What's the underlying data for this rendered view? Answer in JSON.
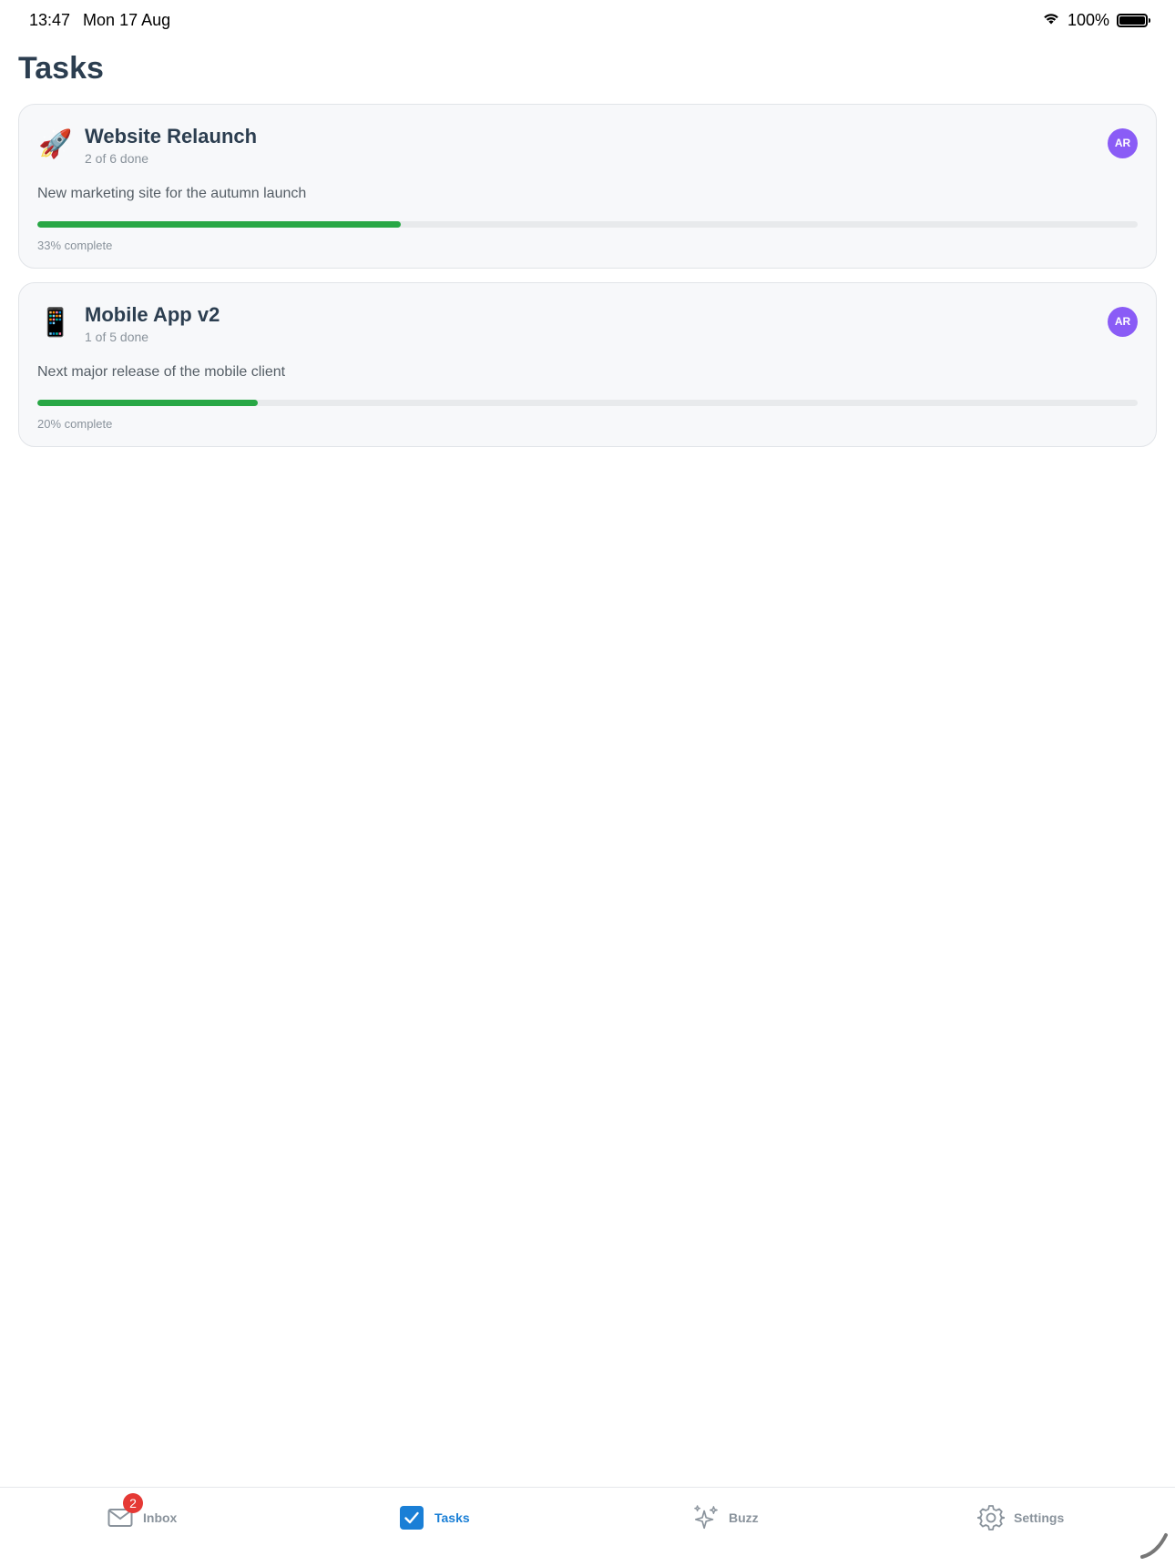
{
  "status_bar": {
    "time": "13:47",
    "date": "Mon 17 Aug",
    "battery": "100%"
  },
  "page": {
    "title": "Tasks"
  },
  "projects": [
    {
      "emoji": "🚀",
      "name": "Website Relaunch",
      "count": "2 of 6 done",
      "description": "New marketing site for the autumn launch",
      "progress": 0.33,
      "progress_text": "33% complete",
      "avatar": "AR"
    },
    {
      "emoji": "📱",
      "name": "Mobile App v2",
      "count": "1 of 5 done",
      "description": "Next major release of the mobile client",
      "progress": 0.2,
      "progress_text": "20% complete",
      "avatar": "AR"
    }
  ],
  "tabs": [
    {
      "label": "Inbox",
      "icon": "mail-icon",
      "badge": "2"
    },
    {
      "label": "Tasks",
      "icon": "checkbox-icon",
      "active": true
    },
    {
      "label": "Buzz",
      "icon": "sparkles-icon"
    },
    {
      "label": "Settings",
      "icon": "gear-icon"
    }
  ],
  "colors": {
    "accent": "#1a7fd6",
    "progress": "#28a745",
    "avatar": "#8a5cf6",
    "badge": "#e53935"
  }
}
